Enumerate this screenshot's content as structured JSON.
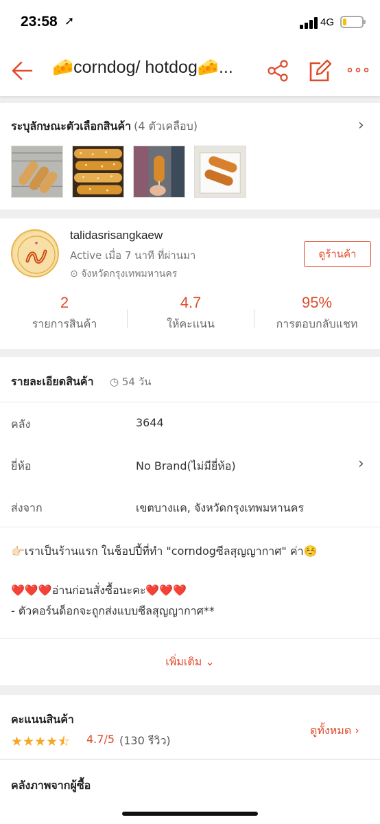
{
  "status_bar": {
    "time": "23:58",
    "location_glyph": "➚",
    "network": "4G",
    "battery_level": 0.2,
    "battery_color": "#f2c400"
  },
  "nav": {
    "title": "corndog/ hotdog",
    "title_prefix_emoji": "🧀",
    "title_suffix_emoji": "🧀",
    "title_ellipsis": "...",
    "accent_color": "#e04a2a",
    "icons": [
      "back-arrow-icon",
      "share-icon",
      "edit-icon",
      "more-icon"
    ]
  },
  "variants": {
    "title": "ระบุลักษณะตัวเลือกสินค้า",
    "count_label": "(4 ตัวเคลือบ)",
    "chevron": "›",
    "thumbnails": [
      "corndog-tray-photo",
      "crispy-corndog-sticks-photo",
      "corndog-in-hand-photo",
      "corndog-in-box-photo"
    ]
  },
  "shop": {
    "name": "talidasrisangkaew",
    "active": "Active เมื่อ 7 นาที ที่ผ่านมา",
    "location_icon": "⊙",
    "location": "จังหวัดกรุงเทพมหานคร",
    "visit_button": "ดูร้านค้า",
    "avatar_label": "SEOUL GOOD CORN DOG",
    "stats": [
      {
        "value": "2",
        "label": "รายการสินค้า"
      },
      {
        "value": "4.7",
        "label": "ให้คะแนน"
      },
      {
        "value": "95%",
        "label": "การตอบกลับแชท"
      }
    ]
  },
  "details": {
    "title": "รายละเอียดสินค้า",
    "age_icon": "◷",
    "age": "54 วัน",
    "rows": [
      {
        "key": "คลัง",
        "value": "3644"
      },
      {
        "key": "ยี่ห้อ",
        "value": "No Brand(ไม่มียี่ห้อ)",
        "chevron": "›"
      },
      {
        "key": "ส่งจาก",
        "value": "เขตบางแค, จังหวัดกรุงเทพมหานคร"
      }
    ],
    "desc_line1": "👉🏻เราเป็นร้านแรก ในช็อปปี้ที่ทำ \"corndogซีลสุญญากาศ\" ค่า☺️",
    "desc_hearts_left": "❤️❤️❤️",
    "desc_line2_text": "อ่านก่อนสั่งซื้อนะคะ",
    "desc_hearts_right": "❤️❤️❤️",
    "desc_line3": "- ตัวคอร์นด็อกจะถูกส่งแบบซีลสุญญากาศ**",
    "more_label": "เพิ่มเติม",
    "more_chevron": "⌄"
  },
  "ratings": {
    "title": "คะแนนสินค้า",
    "stars": "★★★★⯪",
    "rating_value": 4.7,
    "score": "4.7/5",
    "reviews": "(130 รีวิว)",
    "see_all": "ดูทั้งหมด",
    "see_all_chevron": "›"
  },
  "gallery": {
    "title": "คลังภาพจากผู้ซื้อ"
  }
}
